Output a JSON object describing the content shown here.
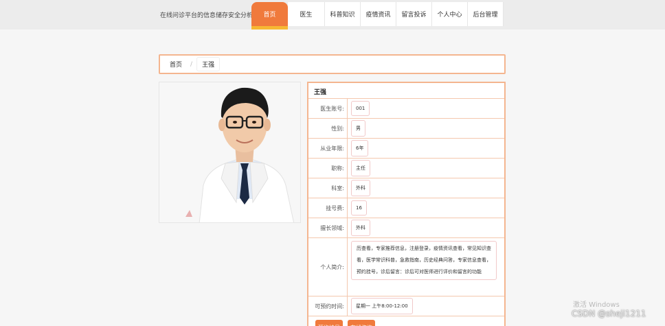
{
  "header": {
    "brand": "在线问诊平台的信息储存安全分析",
    "nav": [
      {
        "label": "首页",
        "active": true
      },
      {
        "label": "医生",
        "active": false
      },
      {
        "label": "科普知识",
        "active": false
      },
      {
        "label": "疫情资讯",
        "active": false
      },
      {
        "label": "留言投诉",
        "active": false
      },
      {
        "label": "个人中心",
        "active": false
      },
      {
        "label": "后台管理",
        "active": false
      }
    ]
  },
  "breadcrumb": {
    "home": "首页",
    "separator": "/",
    "current": "王强"
  },
  "doctor": {
    "name": "王强",
    "fields": [
      {
        "label": "医生账号:",
        "value": "001"
      },
      {
        "label": "性别:",
        "value": "男"
      },
      {
        "label": "从业年限:",
        "value": "6年"
      },
      {
        "label": "职称:",
        "value": "主任"
      },
      {
        "label": "科室:",
        "value": "外科"
      },
      {
        "label": "挂号费:",
        "value": "16"
      },
      {
        "label": "擅长领域:",
        "value": "外科"
      },
      {
        "label": "个人简介:",
        "value": "历查看，专家推荐信息，注册登录，疫情资讯查看，常见知识查看，医学常识科普，急救指南，历史经典问答，专家信息查看，预约挂号，诊后留言：诊后可对医师进行评价和留言的功能"
      },
      {
        "label": "可预约时间:",
        "value": "星期一 上午8:00-12:00"
      }
    ],
    "actions": {
      "book": "预约挂号",
      "consult": "在线咨询"
    }
  },
  "overlay": {
    "activate": "激活 Windows",
    "csdn": "CSDN @sheji1211"
  },
  "colors": {
    "accent": "#f07a3c",
    "accent_strip": "#f7b733",
    "border": "#f4b58f"
  }
}
